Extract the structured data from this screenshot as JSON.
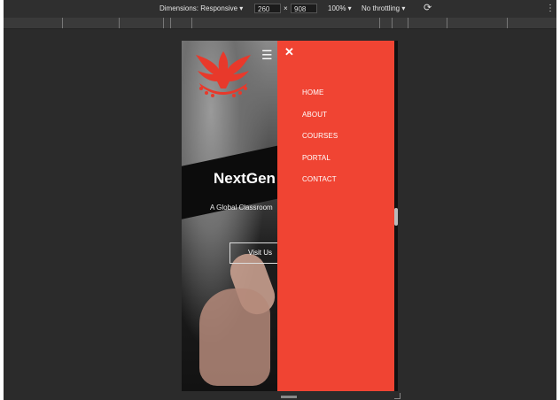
{
  "toolbar": {
    "dimensions_label": "Dimensions: Responsive ▾",
    "width_value": "260",
    "times": "×",
    "height_value": "908",
    "zoom_label": "100% ▾",
    "throttle_label": "No throttling ▾",
    "rotate_icon": "⟳",
    "more_icon": "⋮"
  },
  "site": {
    "hamburger_icon": "☰",
    "hero_title": "NextGen",
    "hero_subtitle": "A Global Classroom",
    "visit_button": "Visit Us"
  },
  "menu": {
    "close_icon": "✕",
    "items": [
      "HOME",
      "ABOUT",
      "COURSES",
      "PORTAL",
      "CONTACT"
    ]
  },
  "colors": {
    "menu_bg": "#f04433",
    "devtools_bg": "#2b2b2b",
    "logo_red": "#e8392b"
  }
}
